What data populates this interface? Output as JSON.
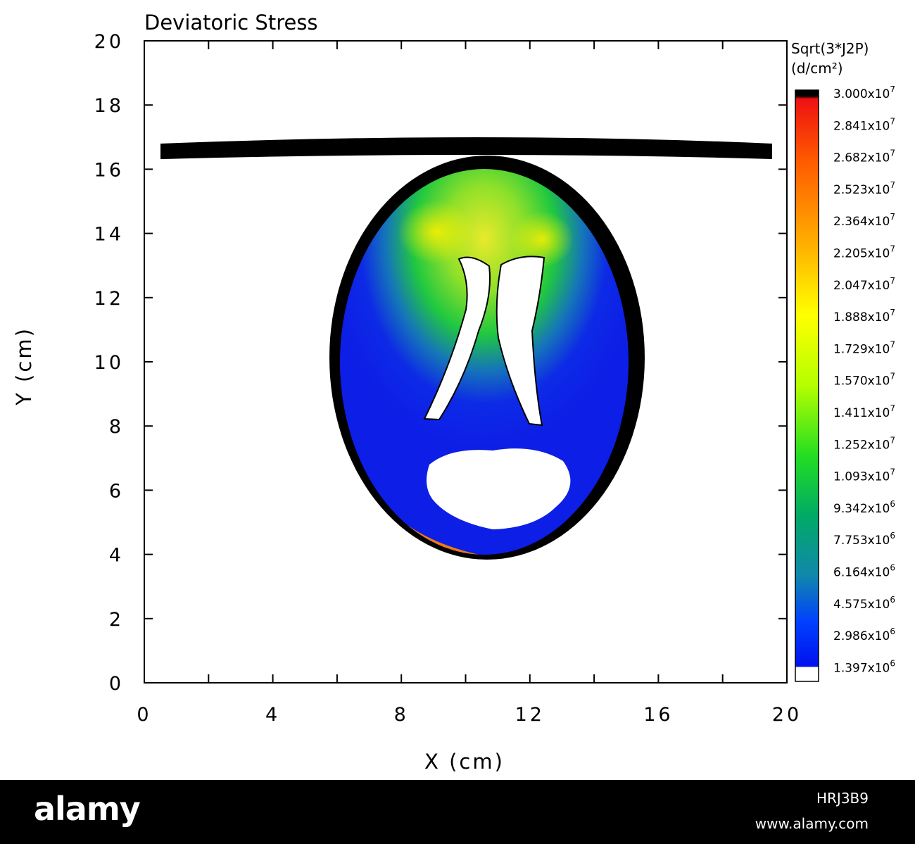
{
  "chart_data": {
    "type": "heatmap",
    "title": "Deviatoric Stress",
    "xlabel": "X (cm)",
    "ylabel": "Y (cm)",
    "xlim": [
      0,
      20
    ],
    "ylim": [
      0,
      20
    ],
    "xticks": [
      "0",
      "4",
      "8",
      "12",
      "16",
      "20"
    ],
    "yticks": [
      "0",
      "2",
      "4",
      "6",
      "8",
      "10",
      "12",
      "14",
      "16",
      "18",
      "20"
    ],
    "grid": false,
    "colorbar": {
      "title_line1": "Sqrt(3*J2P)",
      "title_line2": "(d/cm²)",
      "placement": "right",
      "labels": [
        {
          "mantissa": "3.000",
          "exp": "7"
        },
        {
          "mantissa": "2.841",
          "exp": "7"
        },
        {
          "mantissa": "2.682",
          "exp": "7"
        },
        {
          "mantissa": "2.523",
          "exp": "7"
        },
        {
          "mantissa": "2.364",
          "exp": "7"
        },
        {
          "mantissa": "2.205",
          "exp": "7"
        },
        {
          "mantissa": "2.047",
          "exp": "7"
        },
        {
          "mantissa": "1.888",
          "exp": "7"
        },
        {
          "mantissa": "1.729",
          "exp": "7"
        },
        {
          "mantissa": "1.570",
          "exp": "7"
        },
        {
          "mantissa": "1.411",
          "exp": "7"
        },
        {
          "mantissa": "1.252",
          "exp": "7"
        },
        {
          "mantissa": "1.093",
          "exp": "7"
        },
        {
          "mantissa": "9.342",
          "exp": "6"
        },
        {
          "mantissa": "7.753",
          "exp": "6"
        },
        {
          "mantissa": "6.164",
          "exp": "6"
        },
        {
          "mantissa": "4.575",
          "exp": "6"
        },
        {
          "mantissa": "2.986",
          "exp": "6"
        },
        {
          "mantissa": "1.397",
          "exp": "6"
        }
      ],
      "colors_top_to_bottom": [
        "#000000",
        "#ee1111",
        "#ff6600",
        "#ffcc00",
        "#ffff00",
        "#aaff00",
        "#22dd22",
        "#00aa66",
        "#1188aa",
        "#0033ff",
        "#0011ee",
        "#ffffff"
      ]
    },
    "colors": {
      "skull": "#000000",
      "brain_low": "#0d1ee6",
      "brain_mid": "#2fd23a",
      "brain_high": "#f5e52a",
      "peak": "#f07a10"
    }
  },
  "footer": {
    "logo": "alamy",
    "image_id": "HRJ3B9",
    "url": "www.alamy.com"
  }
}
